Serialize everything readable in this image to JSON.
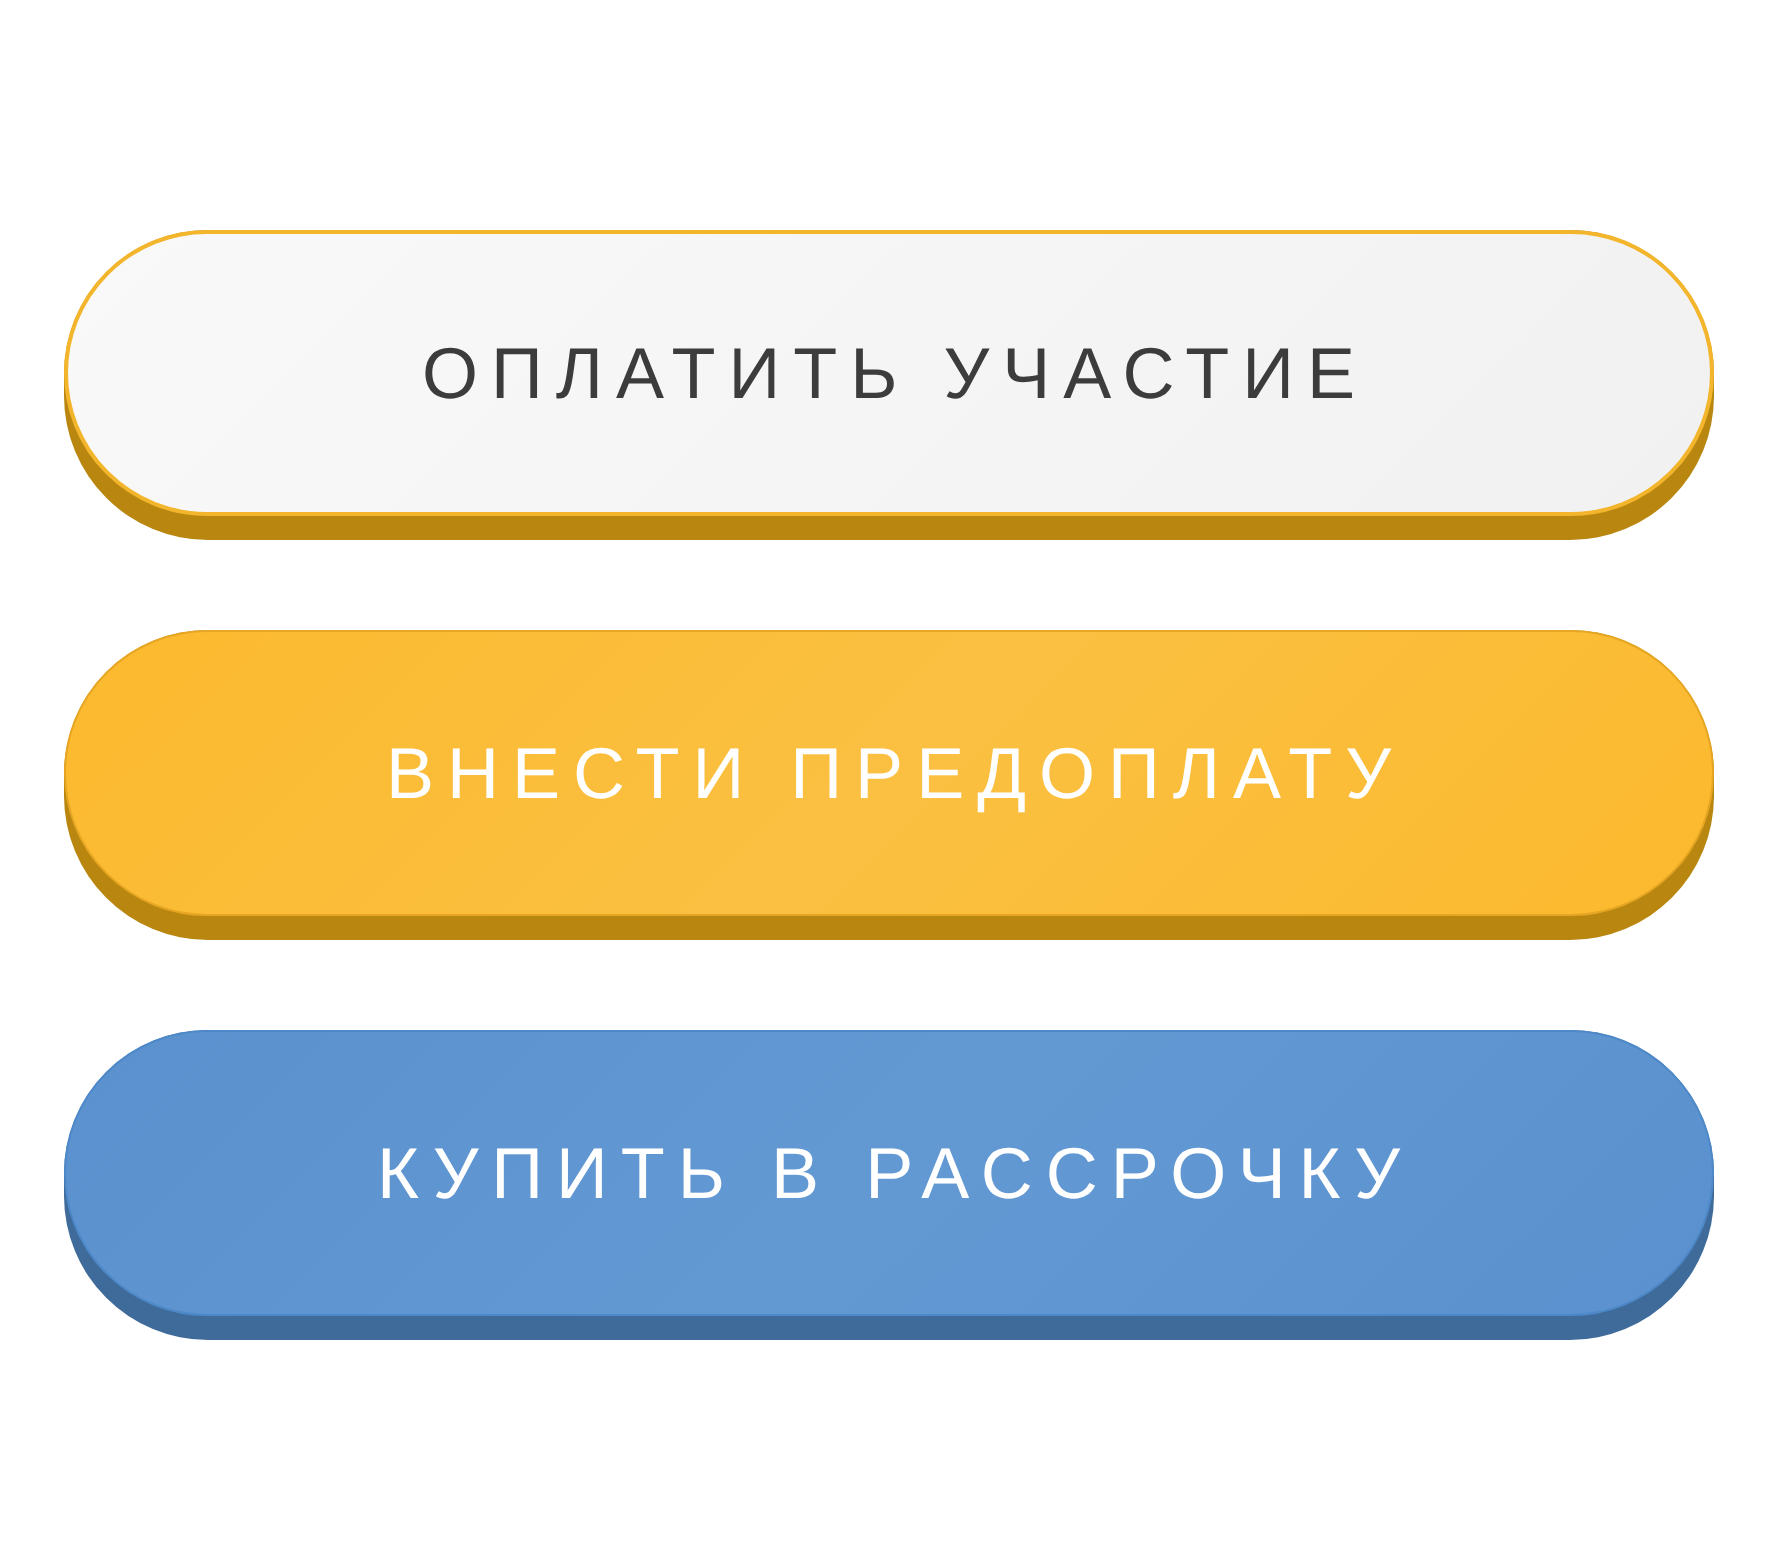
{
  "buttons": [
    {
      "label": "ОПЛАТИТЬ УЧАСТИЕ",
      "kind": "light"
    },
    {
      "label": "ВНЕСТИ ПРЕДОПЛАТУ",
      "kind": "yellow"
    },
    {
      "label": "КУПИТЬ В РАССРОЧКУ",
      "kind": "blue"
    }
  ]
}
